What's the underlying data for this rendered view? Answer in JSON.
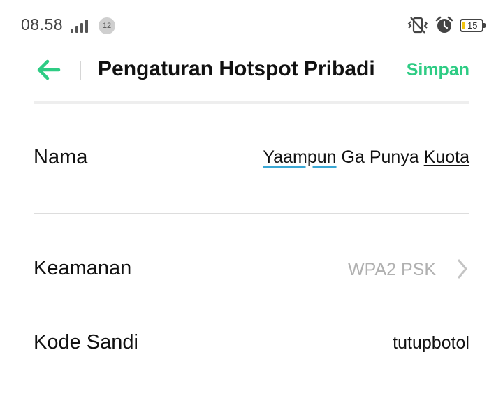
{
  "status_bar": {
    "time": "08.58",
    "notification_count": "12",
    "battery_level": "15",
    "icons": [
      "signal-icon",
      "vibrate-icon",
      "alarm-icon",
      "battery-icon"
    ]
  },
  "header": {
    "title": "Pengaturan Hotspot Pribadi",
    "save_label": "Simpan",
    "back_icon": "arrow-left-icon"
  },
  "form": {
    "name": {
      "label": "Nama",
      "value_words": [
        "Yaampun",
        "Ga",
        "Punya",
        "Kuota"
      ]
    },
    "security": {
      "label": "Keamanan",
      "value": "WPA2 PSK",
      "icon": "chevron-right-icon"
    },
    "password": {
      "label": "Kode Sandi",
      "value": "tutupbotol"
    }
  },
  "colors": {
    "accent": "#2ecc84",
    "cursor_underline": "#3aa7d4",
    "muted_text": "#b0b0b0",
    "battery_low": "#f2c40f"
  }
}
